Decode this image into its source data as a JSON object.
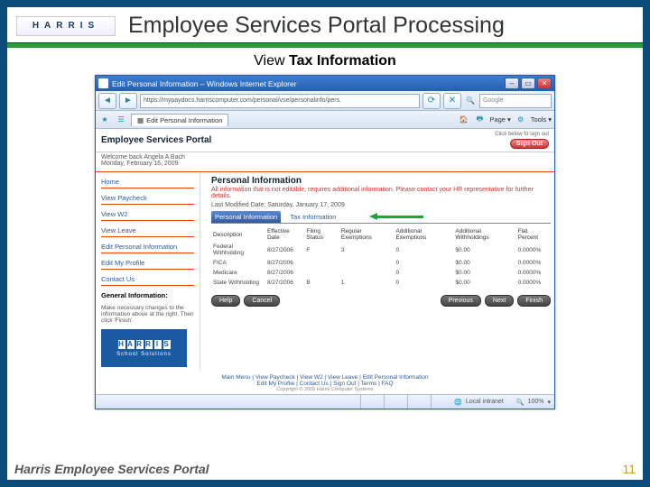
{
  "slide": {
    "logo_text": "HARRIS",
    "title": "Employee Services Portal Processing",
    "subtitle_pre": "View ",
    "subtitle_bold": "Tax Information",
    "footer_name": "Harris Employee Services Portal",
    "page_number": "11"
  },
  "ie": {
    "title": "Edit Personal Information – Windows Internet Explorer",
    "address": "https://mypaydocs.harriscomputer.com/personal/vse/personalinfo/pers.",
    "search_placeholder": "Google",
    "tab_label": "Edit Personal Information",
    "menu_page": "Page",
    "menu_tools": "Tools",
    "status_zone": "Local intranet",
    "status_zoom": "100%"
  },
  "portal": {
    "title": "Employee Services Portal",
    "signout_hint": "Click below to sign out",
    "signout_btn": "Sign Out",
    "welcome_name": "Welcome back Angela A Bach",
    "welcome_date": "Monday, February 16, 2009",
    "footer_links": "Main Menu | View Paycheck | View W2 | View Leave | Edit Personal Information",
    "footer_links2": "Edit My Profile | Contact Us | Sign Out | Terms | FAQ",
    "copyright": "Copyright © 2009 Harris Computer Systems"
  },
  "nav": {
    "items": [
      {
        "label": "Home"
      },
      {
        "label": "View Paycheck"
      },
      {
        "label": "View W2"
      },
      {
        "label": "View Leave"
      },
      {
        "label": "Edit Personal Information"
      },
      {
        "label": "Edit My Profile"
      },
      {
        "label": "Contact Us"
      }
    ],
    "gi_head": "General Information:",
    "gi_body": "Make necessary changes to the information above at the right. Then click 'Finish'.",
    "brand_sub": "School Solutions"
  },
  "main": {
    "heading": "Personal Information",
    "note": "All information that is not editable, requires additional information. Please contact your HR representative for further details.",
    "last_modified": "Last Modified Date: Saturday, January 17, 2009",
    "tab_personal": "Personal Information",
    "tab_tax": "Tax Information",
    "cols": {
      "desc": "Description",
      "eff": "Effective Date",
      "filing": "Filing Status",
      "reg": "Regular Exemptions",
      "add": "Additional Exemptions",
      "addl": "Additional Withholdings",
      "flat": "Flat Percent"
    },
    "rows": [
      {
        "desc": "Federal Withholding",
        "eff": "8/27/2006",
        "filing": "F",
        "reg": "3",
        "add": "0",
        "addl": "$0.00",
        "flat": "0.0000%"
      },
      {
        "desc": "FICA",
        "eff": "8/27/2006",
        "filing": "",
        "reg": "",
        "add": "0",
        "addl": "$0.00",
        "flat": "0.0000%"
      },
      {
        "desc": "Medicare",
        "eff": "8/27/2006",
        "filing": "",
        "reg": "",
        "add": "0",
        "addl": "$0.00",
        "flat": "0.0000%"
      },
      {
        "desc": "State Withholding",
        "eff": "8/27/2006",
        "filing": "B",
        "reg": "1",
        "add": "0",
        "addl": "$0.00",
        "flat": "0.0000%"
      }
    ],
    "btn_help": "Help",
    "btn_cancel": "Cancel",
    "btn_prev": "Previous",
    "btn_next": "Next",
    "btn_finish": "Finish"
  }
}
